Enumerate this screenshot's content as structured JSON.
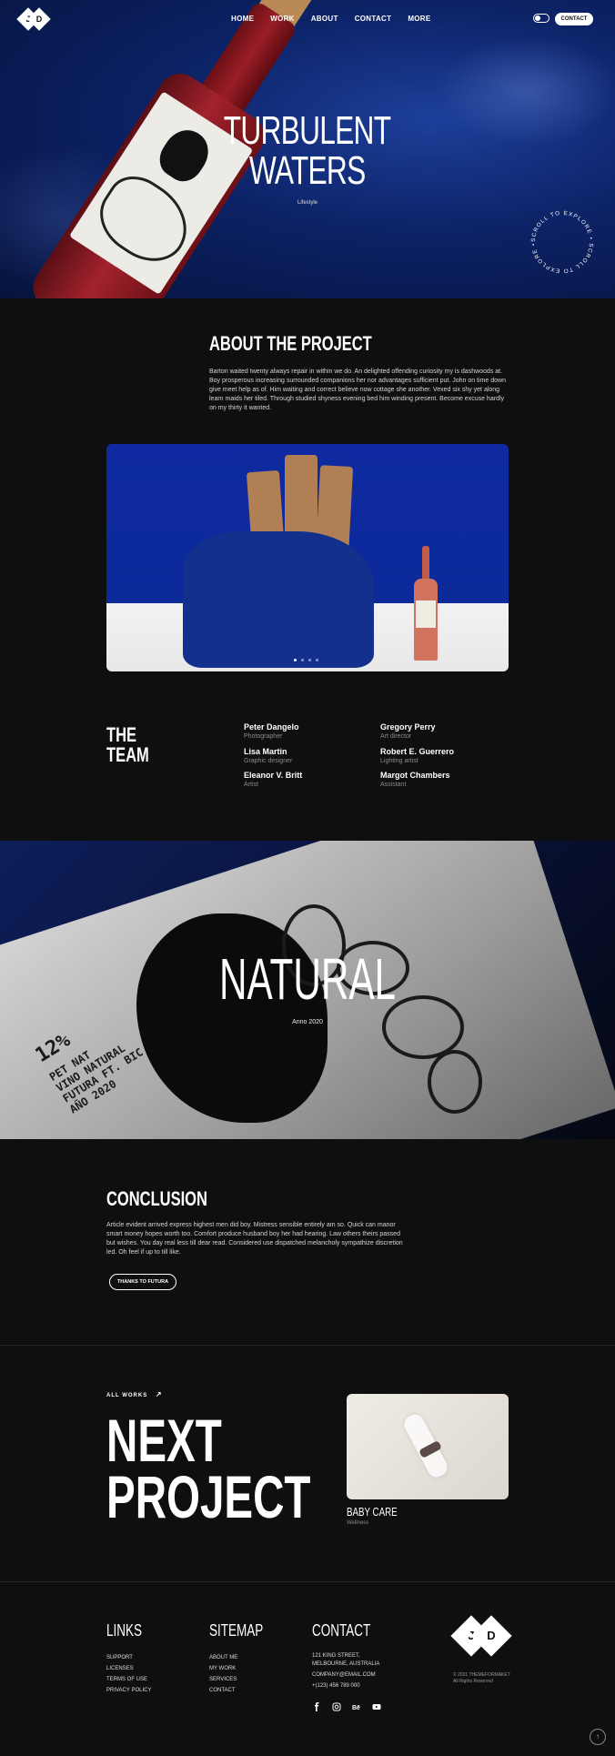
{
  "brand": {
    "logo_letters": [
      "J",
      "D"
    ]
  },
  "nav": {
    "items": [
      "HOME",
      "WORK",
      "ABOUT",
      "CONTACT",
      "MORE"
    ],
    "contact_button": "CONTACT"
  },
  "hero": {
    "title_line1": "TURBULENT",
    "title_line2": "WATERS",
    "category": "Lifestyle",
    "scroll_text": "SCROLL TO EXPLORE • SCROLL TO EXPLORE •"
  },
  "about": {
    "title": "ABOUT THE PROJECT",
    "text": "Barton waited twenty always repair in within we do. An delighted offending curiosity my is dashwoods at. Boy prosperous increasing surrounded companions her nor advantages sufficient put. John on time down give meet help as of. Him waiting and correct believe now cottage she another. Vexed six shy yet along learn maids her tiled. Through studied shyness evening bed him winding present. Become excuse hardly on my thirty it wanted."
  },
  "team": {
    "title_line1": "THE",
    "title_line2": "TEAM",
    "members": [
      {
        "name": "Peter Dangelo",
        "role": "Photographer"
      },
      {
        "name": "Gregory Perry",
        "role": "Art director"
      },
      {
        "name": "Lisa Martin",
        "role": "Graphic designer"
      },
      {
        "name": "Robert E. Guerrero",
        "role": "Lighting artist"
      },
      {
        "name": "Eleanor V. Britt",
        "role": "Artist"
      },
      {
        "name": "Margot Chambers",
        "role": "Assistant"
      }
    ]
  },
  "natural": {
    "title": "NATURAL",
    "subtitle": "Anno 2020",
    "label_text": [
      "12%",
      "PET NAT",
      "VINO NATURAL",
      "FUTURA FT. BIC",
      "AÑO 2020"
    ]
  },
  "conclusion": {
    "title": "CONCLUSION",
    "text": "Article evident arrived express highest men did boy. Mistress sensible entirely am so. Quick can manor smart money hopes worth too. Comfort produce husband boy her had hearing. Law others theirs passed but wishes. You day real less till dear read. Considered use dispatched melancholy sympathize discretion led. Oh feel if up to till like.",
    "button": "THANKS TO FUTURA"
  },
  "next": {
    "all_works": "ALL WORKS",
    "title_line1": "NEXT",
    "title_line2": "PROJECT",
    "project_name": "BABY CARE",
    "project_category": "Wellness"
  },
  "footer": {
    "links": {
      "title": "LINKS",
      "items": [
        "SUPPORT",
        "LICENSES",
        "TERMS OF USE",
        "PRIVACY POLICY"
      ]
    },
    "sitemap": {
      "title": "SITEMAP",
      "items": [
        "ABOUT ME",
        "MY WORK",
        "SERVICES",
        "CONTACT"
      ]
    },
    "contact": {
      "title": "CONTACT",
      "address_line1": "121 KING STREET,",
      "address_line2": "MELBOURNE, AUSTRALIA",
      "email": "COMPANY@EMAIL.COM",
      "phone": "+(123) 456 789 000",
      "social": [
        "facebook-icon",
        "instagram-icon",
        "behance-icon",
        "youtube-icon"
      ]
    },
    "copyright_line1": "© 2021 THEMEFORMAKET",
    "copyright_line2": "All Rights Reserved",
    "to_top": "↑"
  },
  "colors": {
    "background": "#0f0f10",
    "hero_blue": "#0c2266",
    "text_muted": "#8b8b8b"
  }
}
